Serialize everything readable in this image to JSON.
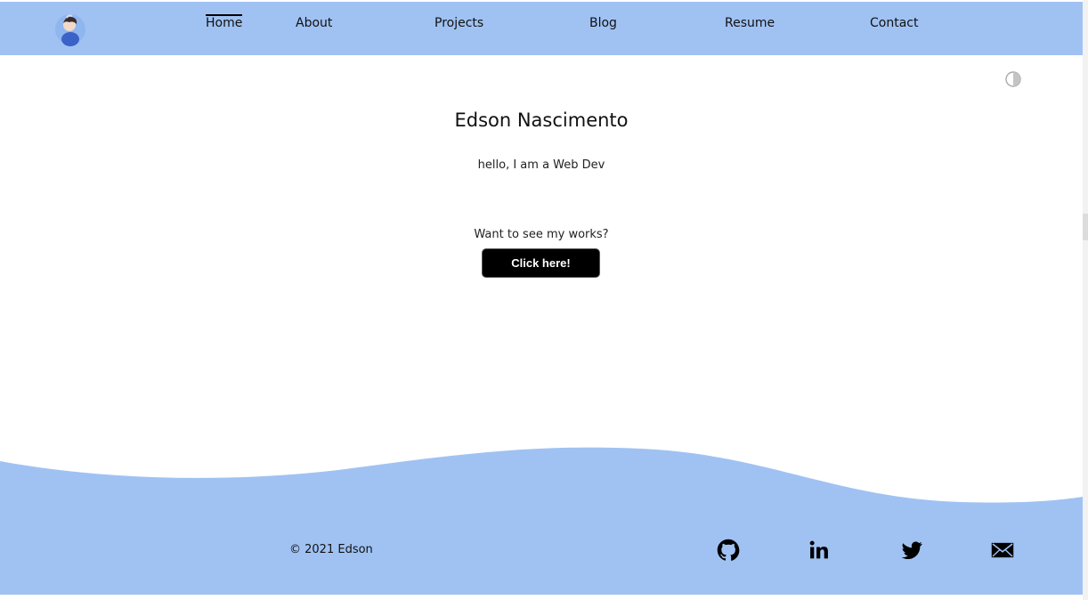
{
  "header": {
    "nav": [
      {
        "label": "Home",
        "active": true
      },
      {
        "label": "About"
      },
      {
        "label": "Projects"
      },
      {
        "label": "Blog"
      },
      {
        "label": "Resume"
      },
      {
        "label": "Contact"
      }
    ],
    "avatar_icon": "cartoon-avatar"
  },
  "theme_toggle": {
    "icon": "half-circle-contrast-icon"
  },
  "hero": {
    "name": "Edson Nascimento",
    "tagline": "hello, I am a Web Dev",
    "prompt": "Want to see my works?",
    "cta_label": "Click here!"
  },
  "footer": {
    "copyright": "© 2021 Edson",
    "social": [
      {
        "name": "github",
        "icon": "github-icon"
      },
      {
        "name": "linkedin",
        "icon": "linkedin-icon"
      },
      {
        "name": "twitter",
        "icon": "twitter-icon"
      },
      {
        "name": "email",
        "icon": "envelope-icon"
      }
    ]
  },
  "colors": {
    "accent": "#a0c2f3",
    "button": "#000000"
  }
}
